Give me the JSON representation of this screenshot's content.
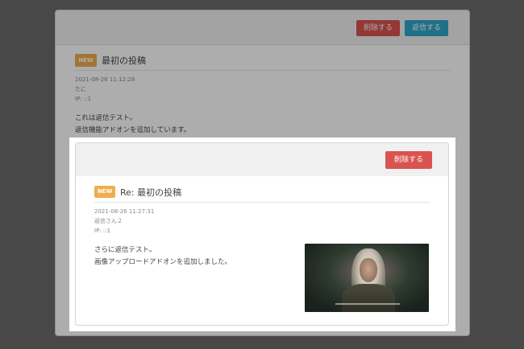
{
  "outer_post": {
    "delete_label": "削除する",
    "reply_label": "返信する",
    "badge": "NEW",
    "title": "最初の投稿",
    "datetime": "2021-08-26 11:12:28",
    "author": "たに",
    "ip": "IP: ::1",
    "body_line1": "これは返信テスト。",
    "body_line2": "返信機能アドオンを追加しています。"
  },
  "reply_post": {
    "delete_label": "削除する",
    "badge": "NEW",
    "title": "Re: 最初の投稿",
    "datetime": "2021-08-26 11:27:31",
    "author": "返信さん２",
    "ip": "IP: ::1",
    "body_line1": "さらに返信テスト。",
    "body_line2": "画像アップロードアドオンを追加しました。"
  },
  "colors": {
    "delete": "#d9534f",
    "reply": "#2fa6c9",
    "badge": "#f0ad4e"
  },
  "icons": {
    "attachment": "attached-image"
  }
}
